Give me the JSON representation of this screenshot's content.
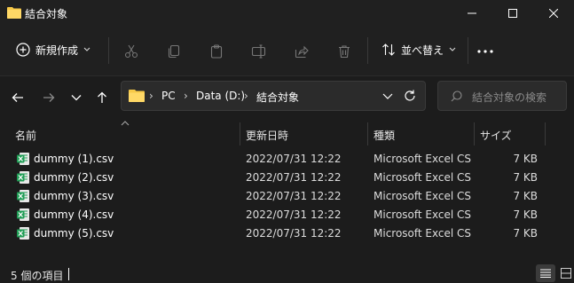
{
  "window": {
    "title": "結合対象"
  },
  "toolbar": {
    "new_label": "新規作成",
    "sort_label": "並べ替え",
    "icons": [
      "cut-icon",
      "copy-icon",
      "paste-icon",
      "rename-icon",
      "share-icon",
      "delete-icon"
    ]
  },
  "address": {
    "crumbs": [
      "PC",
      "Data (D:)",
      "結合対象"
    ],
    "search_placeholder": "結合対象の検索"
  },
  "columns": {
    "name": "名前",
    "date": "更新日時",
    "type": "種類",
    "size": "サイズ"
  },
  "files": [
    {
      "name": "dummy (1).csv",
      "date": "2022/07/31 12:22",
      "type": "Microsoft Excel CS...",
      "size": "7 KB"
    },
    {
      "name": "dummy (2).csv",
      "date": "2022/07/31 12:22",
      "type": "Microsoft Excel CS...",
      "size": "7 KB"
    },
    {
      "name": "dummy (3).csv",
      "date": "2022/07/31 12:22",
      "type": "Microsoft Excel CS...",
      "size": "7 KB"
    },
    {
      "name": "dummy (4).csv",
      "date": "2022/07/31 12:22",
      "type": "Microsoft Excel CS...",
      "size": "7 KB"
    },
    {
      "name": "dummy (5).csv",
      "date": "2022/07/31 12:22",
      "type": "Microsoft Excel CS...",
      "size": "7 KB"
    }
  ],
  "status": {
    "count_text": "5 個の項目"
  },
  "colors": {
    "folder": "#f7c948",
    "excel": "#1f9d55",
    "bg": "#1c1c1c"
  }
}
